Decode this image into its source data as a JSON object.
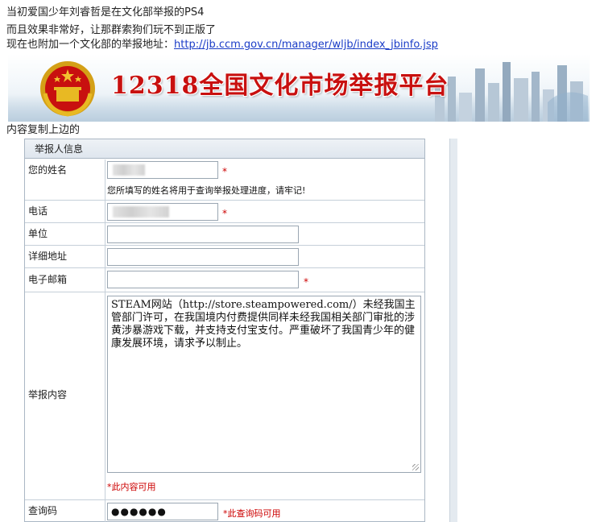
{
  "post": {
    "line1": "当初爱国少年刘睿哲是在文化部举报的PS4",
    "line2": "而且效果非常好，让那群索狗们玩不到正版了",
    "line3_prefix": "现在也附加一个文化部的举报地址：",
    "link": "http://jb.ccm.gov.cn/manager/wljb/index_jbinfo.jsp"
  },
  "banner": {
    "title": "12318全国文化市场举报平台",
    "emblem_icon": "national-emblem-icon",
    "accent_color": "#c8100f"
  },
  "caption": "内容复制上边的",
  "form": {
    "section_title": "举报人信息",
    "required_mark": "*",
    "name": {
      "label": "您的姓名",
      "hint": "您所填写的姓名将用于查询举报处理进度，请牢记!"
    },
    "phone": {
      "label": "电话"
    },
    "unit": {
      "label": "单位"
    },
    "address": {
      "label": "详细地址"
    },
    "email": {
      "label": "电子邮箱"
    },
    "content": {
      "label": "举报内容",
      "value": "STEAM网站（http://store.steampowered.com/）未经我国主管部门许可，在我国境内付费提供同样未经我国相关部门审批的涉黄涉暴游戏下载，并支持支付宝支付。严重破坏了我国青少年的健康发展环境，请求予以制止。",
      "note": "*此内容可用"
    },
    "query_code": {
      "label": "查询码",
      "value": "●●●●●●",
      "note": "*此查询码可用"
    }
  }
}
